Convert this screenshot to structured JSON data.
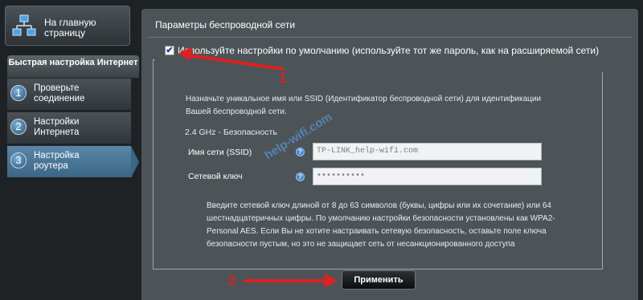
{
  "sidebar": {
    "home_label": "На главную страницу",
    "quick_setup_header": "Быстрая настройка Интернет",
    "steps": [
      {
        "num": "1",
        "label": "Проверьте соединение"
      },
      {
        "num": "2",
        "label": "Настройки Интернета"
      },
      {
        "num": "3",
        "label": "Настройка роутера"
      }
    ]
  },
  "main": {
    "title": "Параметры беспроводной сети",
    "use_default": {
      "checked": true,
      "label": "Используйте настройки по умолчанию (используйте тот же пароль, как на расширяемой сети)"
    },
    "description": "Назначьте уникальное имя или SSID (Идентификатор беспроводной сети) для идентификации Вашей беспроводной сети.",
    "band_label": "2.4 GHz - Безопасность",
    "ssid": {
      "label": "Имя сети (SSID)",
      "value": "TP-LINK_help-wifi.com",
      "help": "?"
    },
    "key": {
      "label": "Сетевой ключ",
      "value": "••••••••••",
      "help": "?"
    },
    "note": "Введите сетевой ключ длиной от 8 до 63 символов (буквы, цифры или их сочетание) или 64 шестнадцатеричных цифры. По умолчанию настройки безопасности установлены как WPA2-Personal AES. Если Вы не хотите настраивать сетевую безопасность, оставьте поле ключа безопасности пустым, но это не защищает сеть от несанкционированного доступа",
    "apply_label": "Применить"
  },
  "annotations": {
    "arrow1_num": "1",
    "arrow2_num": "2",
    "watermark": "help-wifi.com",
    "arrow_color": "#e02020"
  }
}
